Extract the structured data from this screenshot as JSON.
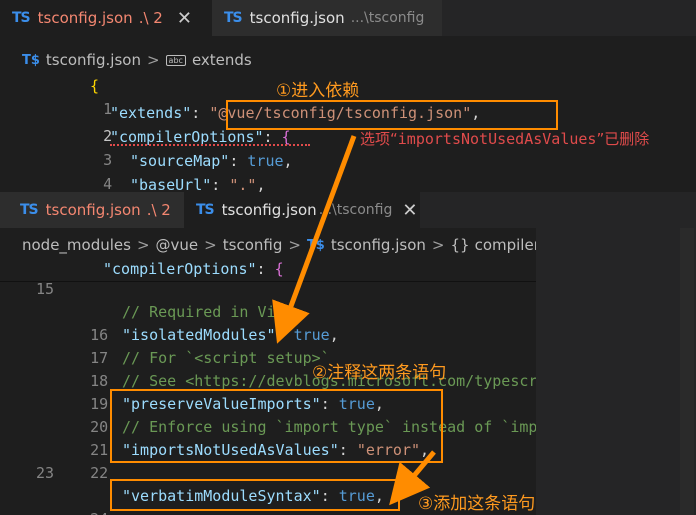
{
  "editor_back": {
    "tabs": [
      {
        "icon": "TS",
        "name": "tsconfig.json",
        "suffix": ".\\ 2",
        "close": "✕"
      },
      {
        "icon": "TS",
        "name": "tsconfig.json",
        "suffix": "...\\tsconfig"
      }
    ],
    "breadcrumbs": {
      "file": "tsconfig.json",
      "sep": ">",
      "symbol_icon": "abc",
      "symbol": "extends"
    },
    "lines": [
      {
        "n": "1",
        "text": "{"
      },
      {
        "n": "2",
        "k": "\"extends\"",
        "colon": ": ",
        "s": "\"@vue/tsconfig/tsconfig.json\"",
        "tail": ","
      },
      {
        "n": "3",
        "k": "\"compilerOptions\"",
        "colon": ": ",
        "tail": "{"
      },
      {
        "n": "4",
        "k": "\"sourceMap\"",
        "colon": ": ",
        "b": "true",
        "tail": ","
      },
      {
        "n": "5",
        "k": "\"baseUrl\"",
        "colon": ": ",
        "s": "\".\"",
        "tail": ","
      }
    ]
  },
  "editor_front": {
    "tabs": [
      {
        "icon": "TS",
        "name": "tsconfig.json",
        "suffix": ".\\ 2"
      },
      {
        "icon": "TS",
        "name": "tsconfig.json",
        "suffix": "...\\tsconfig",
        "close": "✕"
      }
    ],
    "breadcrumbs": {
      "parts": [
        "node_modules",
        "@vue",
        "tsconfig"
      ],
      "file": "tsconfig.json",
      "symbol_icon": "{}",
      "symbol": "compilerOptions",
      "sep": ">"
    },
    "sticky": {
      "k": "\"compilerOptions\"",
      "colon": ": ",
      "tail": "{"
    },
    "lines": [
      {
        "n": "15",
        "type": "blank"
      },
      {
        "n": "16",
        "type": "comment",
        "text": "// Required in Vite"
      },
      {
        "n": "17",
        "type": "kv",
        "k": "\"isolatedModules\"",
        "colon": ": ",
        "b": "true",
        "tail": ","
      },
      {
        "n": "18",
        "type": "comment",
        "text": "// For `<script setup>`"
      },
      {
        "n": "19",
        "type": "comment",
        "text": "// See <https://devblogs.microsoft.com/typescript"
      },
      {
        "n": "20",
        "type": "kv",
        "k": "\"preserveValueImports\"",
        "colon": ": ",
        "b": "true",
        "tail": ","
      },
      {
        "n": "21",
        "type": "comment",
        "text": "// Enforce using `import type` instead of `imp"
      },
      {
        "n": "22",
        "type": "kvs",
        "k": "\"importsNotUsedAsValues\"",
        "colon": ": ",
        "s": "\"error\"",
        "tail": ","
      },
      {
        "n": "23",
        "type": "blank"
      },
      {
        "n": "24",
        "type": "kv",
        "k": "\"verbatimModuleSyntax\"",
        "colon": ": ",
        "b": "true",
        "tail": ","
      }
    ]
  },
  "annotations": {
    "step1": "①进入依赖",
    "step2": "②注释这两条语句",
    "step3": "③添加这条语句",
    "warning_pre": "选项“",
    "warning_code": "importsNotUsedAsValues",
    "warning_post": "”已删除"
  },
  "colors": {
    "accent": "#ff8c00",
    "error": "#e04b4b",
    "ts": "#3b8eea"
  }
}
